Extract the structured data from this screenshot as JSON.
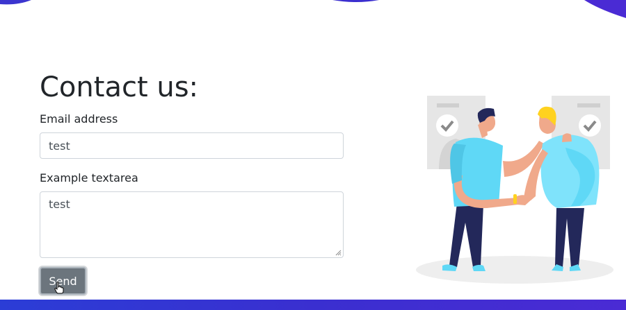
{
  "contact": {
    "heading": "Contact us:",
    "email": {
      "label": "Email address",
      "value": "test"
    },
    "message": {
      "label": "Example textarea",
      "value": "test"
    },
    "send_label": "Send"
  },
  "illustration": {
    "icon": "handshake-illustration"
  },
  "colors": {
    "accent": "#3a2fd0",
    "button": "#6c757d",
    "shirt": "#5fd8f6",
    "pants": "#23285a"
  }
}
